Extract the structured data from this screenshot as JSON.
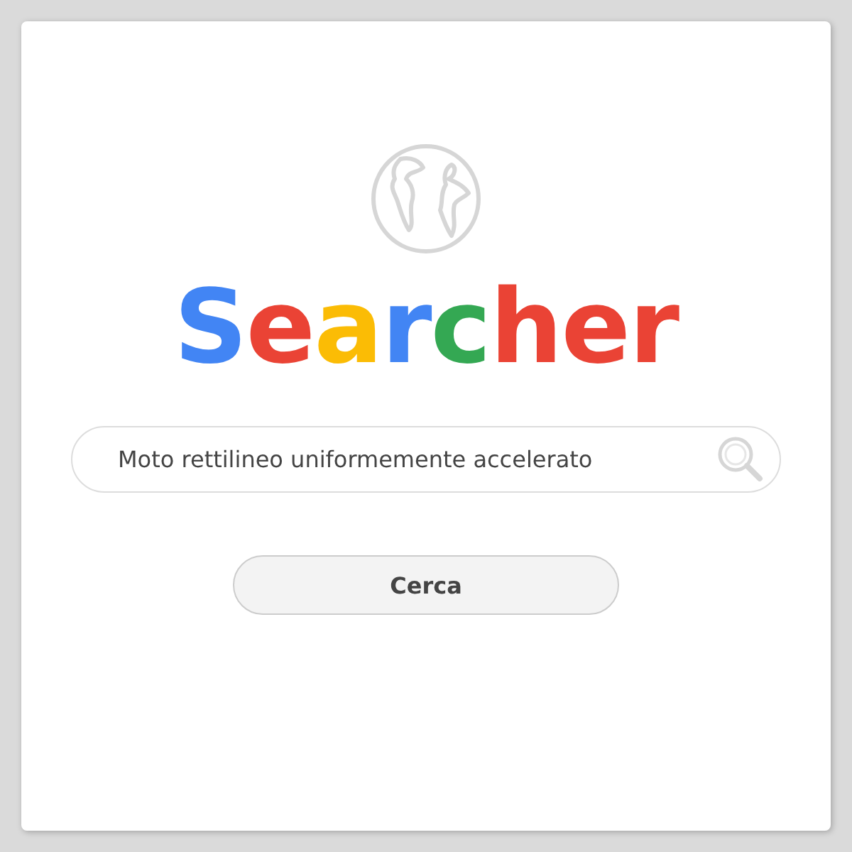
{
  "logo": [
    {
      "text": "S",
      "color": "#4285f4"
    },
    {
      "text": "e",
      "color": "#ea4335"
    },
    {
      "text": "a",
      "color": "#fbbc05"
    },
    {
      "text": "r",
      "color": "#4285f4"
    },
    {
      "text": "c",
      "color": "#34a853"
    },
    {
      "text": "h",
      "color": "#ea4335"
    },
    {
      "text": "e",
      "color": "#ea4335"
    },
    {
      "text": "r",
      "color": "#ea4335"
    }
  ],
  "search": {
    "value": "Moto rettilineo uniformemente accelerato"
  },
  "button": "Cerca"
}
